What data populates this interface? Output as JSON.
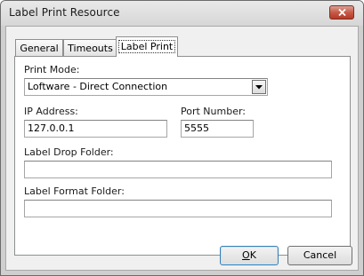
{
  "window": {
    "title": "Label Print Resource"
  },
  "tabs": [
    {
      "label": "General",
      "active": false
    },
    {
      "label": "Timeouts",
      "active": false
    },
    {
      "label": "Label Print",
      "active": true
    }
  ],
  "form": {
    "print_mode_label": "Print Mode:",
    "print_mode_value": "Loftware - Direct Connection",
    "ip_address_label": "IP Address:",
    "ip_address_value": "127.0.0.1",
    "port_number_label": "Port Number:",
    "port_number_value": "5555",
    "label_drop_folder_label": "Label Drop Folder:",
    "label_drop_folder_value": "",
    "label_format_folder_label": "Label Format Folder:",
    "label_format_folder_value": ""
  },
  "buttons": {
    "ok_mnemonic": "O",
    "ok_rest": "K",
    "cancel_label": "Cancel"
  },
  "colors": {
    "close_button": "#c75a47",
    "default_button_border": "#3c7fb1"
  }
}
